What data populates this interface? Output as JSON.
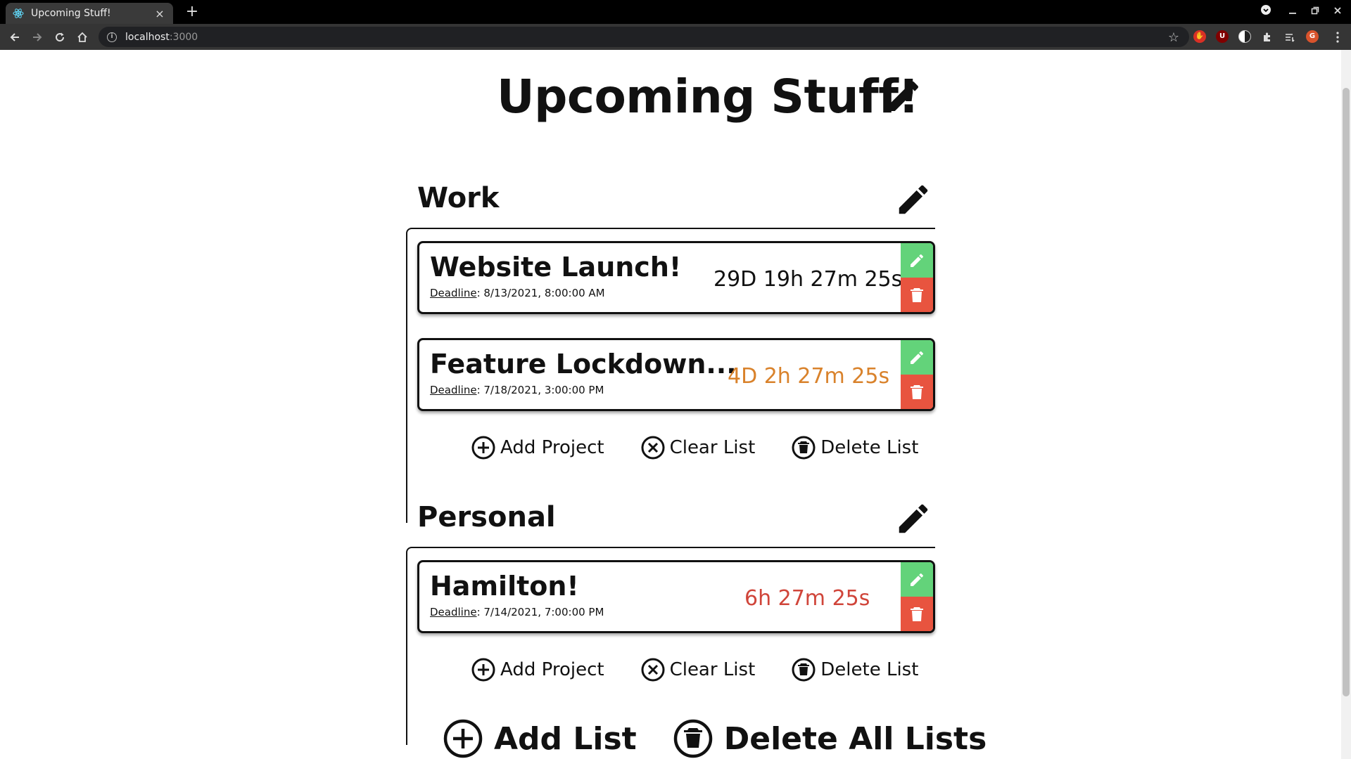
{
  "browser": {
    "tab_title": "Upcoming Stuff!",
    "tab_close": "×",
    "new_tab": "+",
    "url_host": "localhost",
    "url_port": ":3000",
    "profile_initial": "G",
    "ext_u": "U"
  },
  "page": {
    "title": "Upcoming Stuff!",
    "lists": [
      {
        "title": "Work",
        "projects": [
          {
            "name": "Website Launch!",
            "deadline_label": "Deadline",
            "deadline_value": ": 8/13/2021, 8:00:00 AM",
            "timer": "29D 19h 27m 25s",
            "timer_color": "#111111"
          },
          {
            "name": "Feature Lockdown...",
            "deadline_label": "Deadline",
            "deadline_value": ": 7/18/2021, 3:00:00 PM",
            "timer": "4D 2h 27m 25s",
            "timer_color": "#d9822b"
          }
        ],
        "actions": {
          "add_project": "Add Project",
          "clear_list": "Clear List",
          "delete_list": "Delete List"
        }
      },
      {
        "title": "Personal",
        "projects": [
          {
            "name": "Hamilton!",
            "deadline_label": "Deadline",
            "deadline_value": ": 7/14/2021, 7:00:00 PM",
            "timer": "6h 27m 25s",
            "timer_color": "#d0453a"
          }
        ],
        "actions": {
          "add_project": "Add Project",
          "clear_list": "Clear List",
          "delete_list": "Delete List"
        }
      }
    ],
    "global_actions": {
      "add_list": "Add List",
      "delete_all_lists": "Delete All Lists"
    }
  },
  "colors": {
    "edit_green": "#63d37a",
    "delete_red": "#e8543f",
    "warn_orange": "#d9822b",
    "danger_red": "#d0453a"
  },
  "icons": [
    "react-favicon-icon",
    "pencil-icon",
    "trash-icon",
    "plus-circle-icon",
    "x-circle-icon",
    "trash-circle-icon"
  ]
}
